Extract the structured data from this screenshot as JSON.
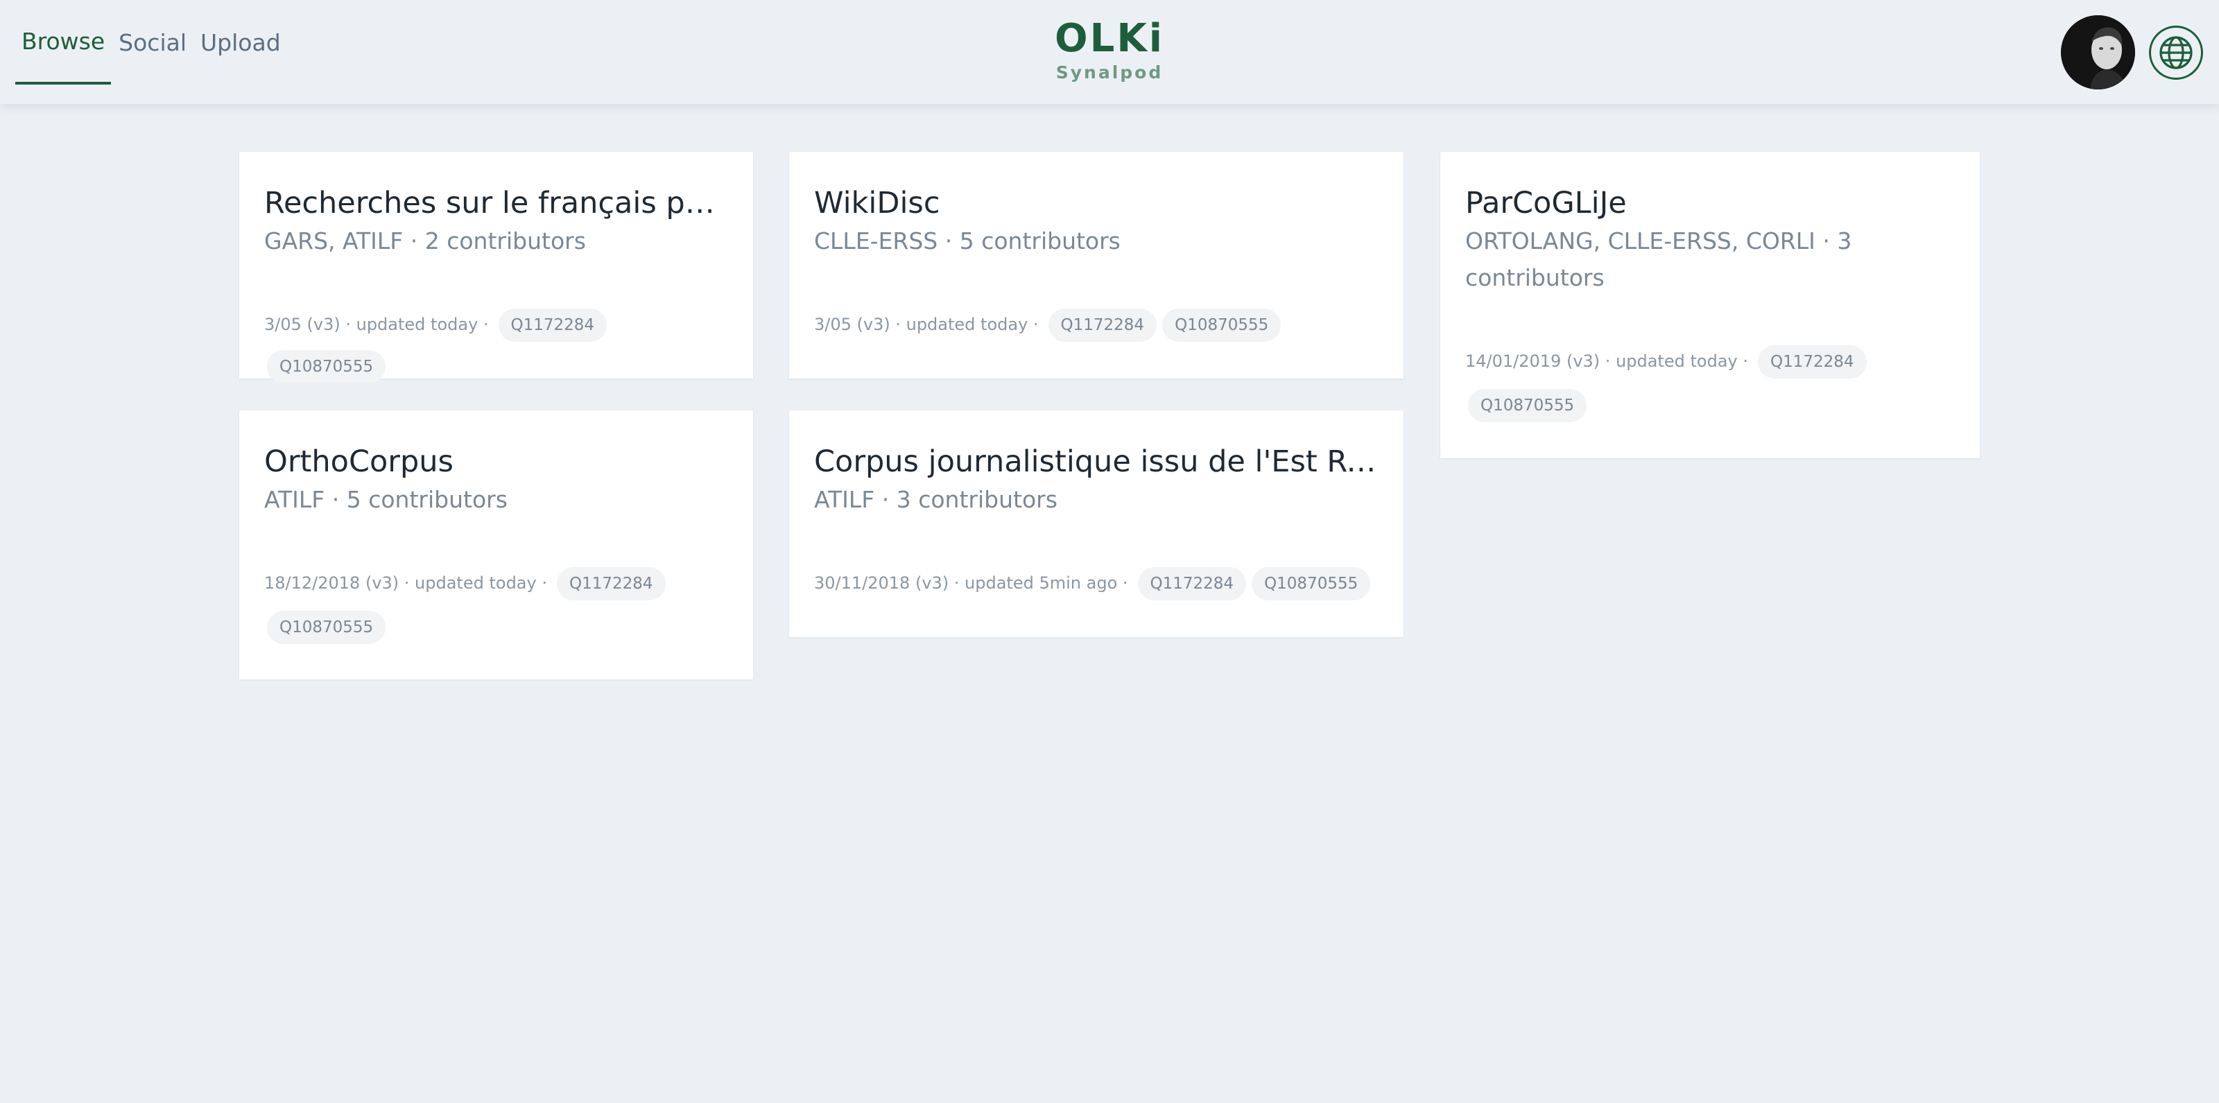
{
  "app": {
    "title": "OLKi",
    "subtitle": "Synalpod"
  },
  "nav": {
    "tabs": [
      {
        "label": "Browse"
      },
      {
        "label": "Social"
      },
      {
        "label": "Upload"
      }
    ]
  },
  "header": {
    "avatar_icon": "user-avatar",
    "language_icon": "globe-icon",
    "accent_color": "#1c5e3b"
  },
  "cards": [
    {
      "title": "Recherches sur le français parlé",
      "subtitle": "GARS, ATILF · 2 contributors",
      "meta": "3/05 (v3) · updated today ·",
      "tags": [
        "Q1172284",
        "Q10870555"
      ]
    },
    {
      "title": "WikiDisc",
      "subtitle": "CLLE-ERSS · 5 contributors",
      "meta": "3/05 (v3) · updated today ·",
      "tags": [
        "Q1172284",
        "Q10870555"
      ]
    },
    {
      "title": "ParCoGLiJe",
      "subtitle_line1": "ORTOLANG, CLLE-ERSS, CORLI · 3",
      "subtitle_line2": "contributors",
      "meta": "14/01/2019 (v3) · updated today ·",
      "tags": [
        "Q1172284",
        "Q10870555"
      ]
    },
    {
      "title": "OrthoCorpus",
      "subtitle": "ATILF · 5 contributors",
      "meta": "18/12/2018 (v3) · updated today ·",
      "tags": [
        "Q1172284",
        "Q10870555"
      ]
    },
    {
      "title": "Corpus journalistique issu de l'Est Républicain",
      "subtitle": "ATILF · 3 contributors",
      "meta": "30/11/2018 (v3) · updated 5min ago ·",
      "tags": [
        "Q1172284",
        "Q10870555"
      ]
    }
  ]
}
